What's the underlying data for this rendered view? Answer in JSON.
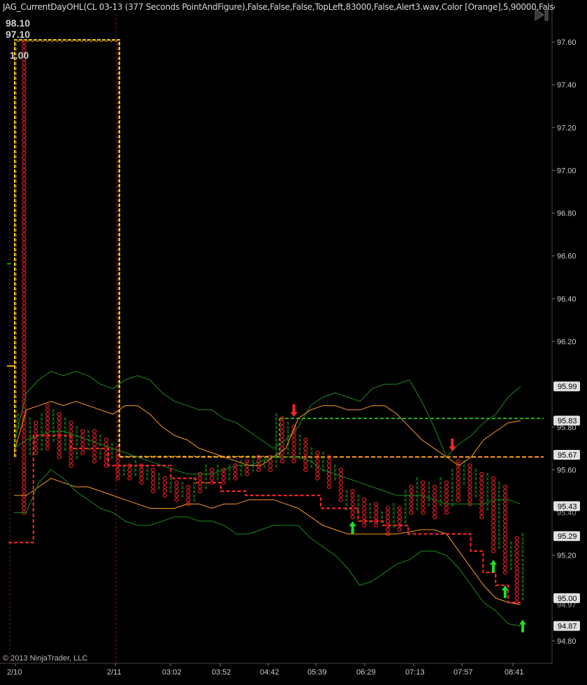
{
  "window": {
    "indicator_title": "JAG_CurrentDayOHL(CL 03-13 (377 Seconds PointAndFigure),False,False,False,TopLeft,83000,False,Alert3.wav,Color [Orange],5,90000,False,Alert3.wav,C",
    "copyright": "© 2013 NinjaTrader, LLC",
    "nav_icon": "skip-to-end-icon"
  },
  "overlay_labels": {
    "high": "98.10",
    "open": "97.10",
    "ratio": "1.00"
  },
  "chart_data": {
    "type": "point-and-figure",
    "instrument": "CL 03-13",
    "period": "377 Seconds PointAndFigure",
    "ylim": [
      94.75,
      97.72
    ],
    "y_ticks": [
      "97.60",
      "97.40",
      "97.20",
      "97.00",
      "96.80",
      "96.60",
      "96.40",
      "96.20",
      "95.80",
      "95.60",
      "95.20",
      "94.80"
    ],
    "x_ticks": [
      "2/10",
      "2/11",
      "03:02",
      "03:52",
      "04:42",
      "05:39",
      "06:29",
      "07:13",
      "07:57",
      "08:41"
    ],
    "price_markers": [
      {
        "label": "95.99",
        "bg": "#e0e0e0",
        "fg": "#000000"
      },
      {
        "label": "95.83",
        "bg": "#e0e0e0",
        "fg": "#000000"
      },
      {
        "label": "95.67",
        "bg": "#e0e0e0",
        "fg": "#000000"
      },
      {
        "label": "95.43",
        "bg": "#e0e0e0",
        "fg": "#000000"
      },
      {
        "label": "95.29",
        "bg": "#e0e0e0",
        "fg": "#000000"
      },
      {
        "label": "95.00",
        "bg": "#e0e0e0",
        "fg": "#000000"
      },
      {
        "label": "94.87",
        "bg": "#e0e0e0",
        "fg": "#000000"
      }
    ],
    "hidden_tick_labels": [
      "95.40",
      "94.97"
    ],
    "session_dividers": [
      "2/10",
      "2/11"
    ],
    "levels": {
      "prior_high": 95.84,
      "current_open": 95.66,
      "session_box_top": 97.61
    },
    "colors": {
      "x_box": "#1fae1f",
      "o_box": "#e02020",
      "bollinger": "#1e8a1e",
      "keltner": "#ff9a1f",
      "stop_line": "#ff2a2a",
      "yellow_box": "#f0d010",
      "prior_high_line": "#1fae1f",
      "open_line": "#ff9a1f",
      "arrow_up": "#22dd22",
      "arrow_down": "#ff2222"
    },
    "columns": [
      {
        "c": "X",
        "lo": 95.8,
        "hi": 95.86
      },
      {
        "c": "O",
        "lo": 95.4,
        "hi": 97.61
      },
      {
        "c": "X",
        "lo": 95.68,
        "hi": 95.84
      },
      {
        "c": "O",
        "lo": 95.68,
        "hi": 95.82
      },
      {
        "c": "X",
        "lo": 95.7,
        "hi": 95.86
      },
      {
        "c": "O",
        "lo": 95.7,
        "hi": 95.9
      },
      {
        "c": "X",
        "lo": 95.74,
        "hi": 95.88
      },
      {
        "c": "O",
        "lo": 95.66,
        "hi": 95.86
      },
      {
        "c": "X",
        "lo": 95.7,
        "hi": 95.84
      },
      {
        "c": "O",
        "lo": 95.62,
        "hi": 95.82
      },
      {
        "c": "X",
        "lo": 95.66,
        "hi": 95.8
      },
      {
        "c": "O",
        "lo": 95.68,
        "hi": 95.78
      },
      {
        "c": "X",
        "lo": 95.7,
        "hi": 95.78
      },
      {
        "c": "O",
        "lo": 95.64,
        "hi": 95.78
      },
      {
        "c": "X",
        "lo": 95.66,
        "hi": 95.76
      },
      {
        "c": "O",
        "lo": 95.62,
        "hi": 95.74
      },
      {
        "c": "X",
        "lo": 95.66,
        "hi": 95.72
      },
      {
        "c": "O",
        "lo": 95.56,
        "hi": 95.7
      },
      {
        "c": "X",
        "lo": 95.58,
        "hi": 95.62
      },
      {
        "c": "O",
        "lo": 95.56,
        "hi": 95.62
      },
      {
        "c": "X",
        "lo": 95.58,
        "hi": 95.64
      },
      {
        "c": "O",
        "lo": 95.54,
        "hi": 95.62
      },
      {
        "c": "X",
        "lo": 95.56,
        "hi": 95.62
      },
      {
        "c": "O",
        "lo": 95.5,
        "hi": 95.6
      },
      {
        "c": "X",
        "lo": 95.52,
        "hi": 95.58
      },
      {
        "c": "O",
        "lo": 95.48,
        "hi": 95.56
      },
      {
        "c": "X",
        "lo": 95.5,
        "hi": 95.56
      },
      {
        "c": "O",
        "lo": 95.46,
        "hi": 95.54
      },
      {
        "c": "X",
        "lo": 95.48,
        "hi": 95.54
      },
      {
        "c": "O",
        "lo": 95.44,
        "hi": 95.52
      },
      {
        "c": "X",
        "lo": 95.46,
        "hi": 95.56
      },
      {
        "c": "O",
        "lo": 95.5,
        "hi": 95.58
      },
      {
        "c": "X",
        "lo": 95.52,
        "hi": 95.62
      },
      {
        "c": "O",
        "lo": 95.54,
        "hi": 95.6
      },
      {
        "c": "X",
        "lo": 95.56,
        "hi": 95.62
      },
      {
        "c": "O",
        "lo": 95.54,
        "hi": 95.6
      },
      {
        "c": "X",
        "lo": 95.56,
        "hi": 95.62
      },
      {
        "c": "O",
        "lo": 95.56,
        "hi": 95.62
      },
      {
        "c": "X",
        "lo": 95.58,
        "hi": 95.64
      },
      {
        "c": "O",
        "lo": 95.58,
        "hi": 95.64
      },
      {
        "c": "X",
        "lo": 95.6,
        "hi": 95.66
      },
      {
        "c": "O",
        "lo": 95.6,
        "hi": 95.66
      },
      {
        "c": "X",
        "lo": 95.62,
        "hi": 95.66
      },
      {
        "c": "O",
        "lo": 95.6,
        "hi": 95.66
      },
      {
        "c": "X",
        "lo": 95.62,
        "hi": 95.86
      },
      {
        "c": "O",
        "lo": 95.64,
        "hi": 95.84
      },
      {
        "c": "X",
        "lo": 95.68,
        "hi": 95.82
      },
      {
        "c": "O",
        "lo": 95.64,
        "hi": 95.8
      },
      {
        "c": "X",
        "lo": 95.66,
        "hi": 95.76
      },
      {
        "c": "O",
        "lo": 95.6,
        "hi": 95.74
      },
      {
        "c": "X",
        "lo": 95.62,
        "hi": 95.7
      },
      {
        "c": "O",
        "lo": 95.56,
        "hi": 95.68
      },
      {
        "c": "X",
        "lo": 95.6,
        "hi": 95.68
      },
      {
        "c": "O",
        "lo": 95.52,
        "hi": 95.66
      },
      {
        "c": "X",
        "lo": 95.56,
        "hi": 95.62
      },
      {
        "c": "O",
        "lo": 95.46,
        "hi": 95.6
      },
      {
        "c": "X",
        "lo": 95.42,
        "hi": 95.5
      },
      {
        "c": "O",
        "lo": 95.38,
        "hi": 95.5
      },
      {
        "c": "X",
        "lo": 95.4,
        "hi": 95.48
      },
      {
        "c": "O",
        "lo": 95.34,
        "hi": 95.46
      },
      {
        "c": "X",
        "lo": 95.36,
        "hi": 95.44
      },
      {
        "c": "O",
        "lo": 95.34,
        "hi": 95.44
      },
      {
        "c": "X",
        "lo": 95.36,
        "hi": 95.4
      },
      {
        "c": "O",
        "lo": 95.3,
        "hi": 95.42
      },
      {
        "c": "X",
        "lo": 95.34,
        "hi": 95.44
      },
      {
        "c": "O",
        "lo": 95.32,
        "hi": 95.42
      },
      {
        "c": "X",
        "lo": 95.36,
        "hi": 95.5
      },
      {
        "c": "O",
        "lo": 95.4,
        "hi": 95.52
      },
      {
        "c": "X",
        "lo": 95.42,
        "hi": 95.56
      },
      {
        "c": "O",
        "lo": 95.4,
        "hi": 95.54
      },
      {
        "c": "X",
        "lo": 95.44,
        "hi": 95.54
      },
      {
        "c": "O",
        "lo": 95.38,
        "hi": 95.52
      },
      {
        "c": "X",
        "lo": 95.44,
        "hi": 95.56
      },
      {
        "c": "O",
        "lo": 95.4,
        "hi": 95.54
      },
      {
        "c": "X",
        "lo": 95.44,
        "hi": 95.6
      },
      {
        "c": "O",
        "lo": 95.46,
        "hi": 95.64
      },
      {
        "c": "X",
        "lo": 95.54,
        "hi": 95.64
      },
      {
        "c": "O",
        "lo": 95.44,
        "hi": 95.62
      },
      {
        "c": "X",
        "lo": 95.48,
        "hi": 95.6
      },
      {
        "c": "O",
        "lo": 95.38,
        "hi": 95.58
      },
      {
        "c": "X",
        "lo": 95.42,
        "hi": 95.58
      },
      {
        "c": "O",
        "lo": 95.22,
        "hi": 95.56
      },
      {
        "c": "X",
        "lo": 95.24,
        "hi": 95.54
      },
      {
        "c": "O",
        "lo": 95.12,
        "hi": 95.52
      },
      {
        "c": "X",
        "lo": 95.14,
        "hi": 95.26
      },
      {
        "c": "O",
        "lo": 94.98,
        "hi": 95.28
      },
      {
        "c": "X",
        "lo": 95.0,
        "hi": 95.3
      }
    ],
    "series": [
      {
        "kind": "bollinger",
        "values": [
          95.72,
          95.96,
          96.02,
          96.06,
          96.04,
          96.06,
          96.04,
          96.0,
          95.98,
          96.02,
          96.04,
          96.02,
          95.96,
          95.92,
          95.9,
          95.88,
          95.88,
          95.84,
          95.82,
          95.78,
          95.74,
          95.7,
          95.74,
          95.8,
          95.9,
          95.94,
          95.96,
          95.94,
          95.92,
          95.98,
          96.0,
          96.0,
          96.02,
          95.92,
          95.8,
          95.66,
          95.72,
          95.76,
          95.82,
          95.86,
          95.94,
          95.99
        ]
      },
      {
        "kind": "keltner",
        "values": [
          95.68,
          95.88,
          95.9,
          95.92,
          95.9,
          95.92,
          95.9,
          95.88,
          95.86,
          95.9,
          95.9,
          95.86,
          95.8,
          95.76,
          95.74,
          95.7,
          95.68,
          95.66,
          95.64,
          95.62,
          95.62,
          95.66,
          95.7,
          95.84,
          95.88,
          95.9,
          95.9,
          95.88,
          95.88,
          95.9,
          95.9,
          95.86,
          95.8,
          95.74,
          95.7,
          95.66,
          95.62,
          95.66,
          95.74,
          95.78,
          95.82,
          95.83
        ]
      },
      {
        "kind": "bollinger",
        "values": [
          95.7,
          95.74,
          95.76,
          95.78,
          95.78,
          95.76,
          95.74,
          95.72,
          95.7,
          95.68,
          95.66,
          95.64,
          95.62,
          95.6,
          95.58,
          95.58,
          95.58,
          95.6,
          95.62,
          95.62,
          95.64,
          95.66,
          95.66,
          95.66,
          95.64,
          95.6,
          95.58,
          95.56,
          95.54,
          95.52,
          95.5,
          95.48,
          95.48,
          95.48,
          95.46,
          95.44,
          95.44,
          95.44,
          95.44,
          95.46,
          95.46,
          95.44
        ]
      },
      {
        "kind": "keltner",
        "values": [
          95.48,
          95.48,
          95.52,
          95.56,
          95.54,
          95.52,
          95.52,
          95.5,
          95.48,
          95.46,
          95.44,
          95.42,
          95.42,
          95.42,
          95.44,
          95.44,
          95.42,
          95.44,
          95.44,
          95.46,
          95.46,
          95.46,
          95.44,
          95.42,
          95.38,
          95.34,
          95.32,
          95.3,
          95.3,
          95.3,
          95.3,
          95.3,
          95.31,
          95.32,
          95.32,
          95.3,
          95.22,
          95.14,
          95.06,
          95.0,
          94.98,
          94.97
        ]
      },
      {
        "kind": "bollinger",
        "values": [
          95.4,
          95.4,
          95.54,
          95.6,
          95.56,
          95.5,
          95.46,
          95.42,
          95.4,
          95.36,
          95.34,
          95.34,
          95.36,
          95.38,
          95.38,
          95.36,
          95.36,
          95.34,
          95.3,
          95.3,
          95.32,
          95.34,
          95.34,
          95.34,
          95.28,
          95.24,
          95.2,
          95.14,
          95.06,
          95.08,
          95.12,
          95.16,
          95.18,
          95.22,
          95.22,
          95.2,
          95.14,
          95.06,
          94.98,
          94.94,
          94.88,
          94.87
        ]
      }
    ],
    "stop_line": [
      95.26,
      95.26,
      95.76,
      95.76,
      95.76,
      95.7,
      95.7,
      95.7,
      95.62,
      95.62,
      95.62,
      95.62,
      95.62,
      95.56,
      95.56,
      95.54,
      95.54,
      95.5,
      95.5,
      95.48,
      95.48,
      95.48,
      95.48,
      95.48,
      95.48,
      95.42,
      95.42,
      95.42,
      95.36,
      95.36,
      95.34,
      95.34,
      95.3,
      95.3,
      95.3,
      95.3,
      95.3,
      95.22,
      95.12,
      95.06,
      94.98,
      94.98
    ],
    "signals": [
      {
        "dir": "down",
        "x_index": 47,
        "price": 95.88
      },
      {
        "dir": "up",
        "x_index": 57,
        "price": 95.32
      },
      {
        "dir": "down",
        "x_index": 74,
        "price": 95.72
      },
      {
        "dir": "up",
        "x_index": 81,
        "price": 95.14
      },
      {
        "dir": "up",
        "x_index": 83,
        "price": 95.02
      },
      {
        "dir": "up",
        "x_index": 86,
        "price": 94.86
      }
    ]
  }
}
